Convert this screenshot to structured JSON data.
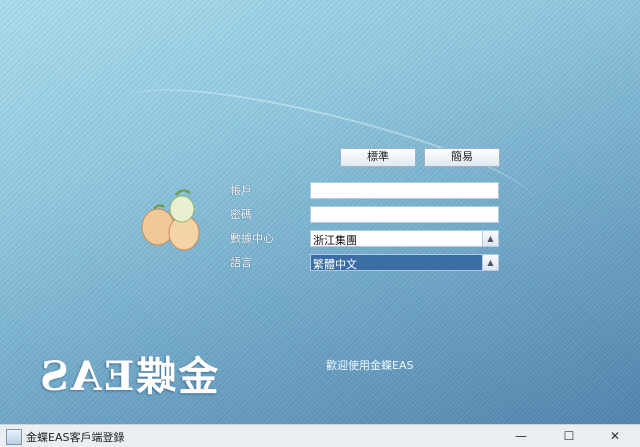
{
  "top_buttons": {
    "left_label": "標準",
    "right_label": "簡易"
  },
  "form": {
    "username_label": "帳戶",
    "username_value": "",
    "password_label": "密碼",
    "password_value": "",
    "datacenter_label": "數據中心",
    "datacenter_value": "浙江集團",
    "language_label": "語言",
    "language_value": "繁體中文"
  },
  "brand": {
    "text": "金蝶EAS"
  },
  "hint": {
    "text": "歡迎使用金蝶EAS"
  },
  "window": {
    "title": "金蝶EAS客戶端登錄"
  },
  "icons": {
    "min": "minimize-icon",
    "max": "maximize-icon",
    "close": "close-icon"
  },
  "colors": {
    "accent": "#3a6ea5",
    "background": "#8fc9de"
  }
}
